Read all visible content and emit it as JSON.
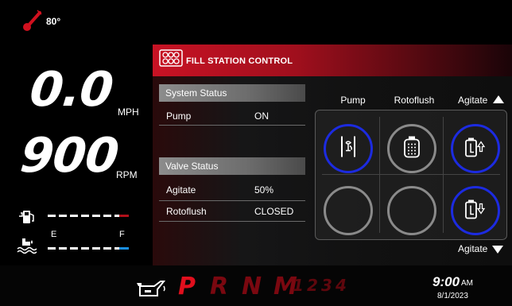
{
  "top": {
    "temperature": "80°"
  },
  "gauges": {
    "speed": "0.0",
    "speed_unit": "MPH",
    "rpm": "900",
    "rpm_unit": "RPM",
    "tank_empty_label": "E",
    "tank_full_label": "F",
    "fuel_level": 0.9,
    "water_level": 0.9
  },
  "panel": {
    "title": "FILL STATION CONTROL",
    "system_status": {
      "heading": "System Status",
      "rows": [
        {
          "label": "Pump",
          "value": "ON"
        }
      ]
    },
    "valve_status": {
      "heading": "Valve Status",
      "rows": [
        {
          "label": "Agitate",
          "value": "50%"
        },
        {
          "label": "Rotoflush",
          "value": "CLOSED"
        }
      ]
    },
    "controls": {
      "col_pump": "Pump",
      "col_rotoflush": "Rotoflush",
      "col_agitate_up": "Agitate",
      "agitate_down": "Agitate"
    }
  },
  "bottom": {
    "gears": [
      "P",
      "R",
      "N",
      "M",
      "1",
      "2",
      "3",
      "4"
    ],
    "active_gear": "P",
    "time": "9:00",
    "ampm": "AM",
    "date": "8/1/2023"
  },
  "colors": {
    "accent_red": "#c81224",
    "active_ring": "#1c2be0",
    "inactive_ring": "#8a8a8a"
  },
  "icons": {
    "temperature": "thermometer-icon",
    "fuel": "fuel-pump-icon",
    "water": "water-tank-icon",
    "header": "fill-station-icon",
    "pump": "pump-icon",
    "rotoflush": "rotoflush-icon",
    "agitate_up": "agitate-up-icon",
    "agitate_down": "agitate-down-icon",
    "oil": "oil-can-icon"
  }
}
